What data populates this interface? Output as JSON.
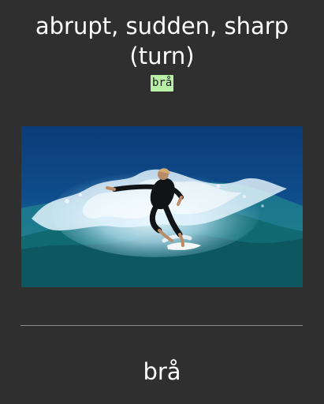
{
  "card": {
    "front_text": "abrupt, sudden, sharp (turn)",
    "hint": "brå",
    "answer": "brå",
    "image_subject": "surfer-turning-on-wave"
  }
}
